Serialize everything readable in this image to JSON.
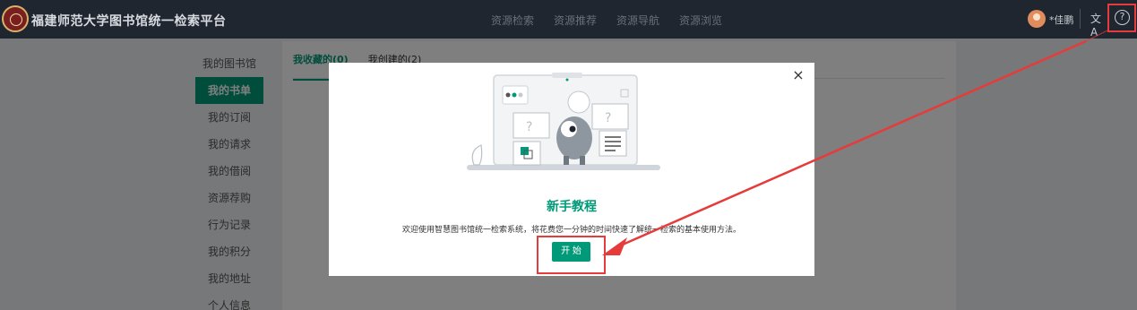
{
  "header": {
    "site_title": "福建师范大学图书馆统一检索平台",
    "nav": [
      "资源检索",
      "资源推荐",
      "资源导航",
      "资源浏览"
    ],
    "user_name": "*佳鹏",
    "translate_glyph": "文A",
    "help_glyph": "?"
  },
  "sidebar": {
    "heading": "我的图书馆",
    "items": [
      "我的书单",
      "我的订阅",
      "我的请求",
      "我的借阅",
      "资源荐购",
      "行为记录",
      "我的积分",
      "我的地址",
      "个人信息"
    ],
    "active_index": 0
  },
  "main": {
    "tabs": [
      "我收藏的(0)",
      "我创建的(2)"
    ],
    "active_tab": 0
  },
  "modal": {
    "close_glyph": "×",
    "title": "新手教程",
    "description": "欢迎使用智慧图书馆统一检索系统，将花费您一分钟的时间快速了解统一检索的基本使用方法。",
    "start_label": "开 始"
  },
  "colors": {
    "topbar": "#20262f",
    "accent": "#009a78",
    "annotation": "#e63b3b"
  }
}
